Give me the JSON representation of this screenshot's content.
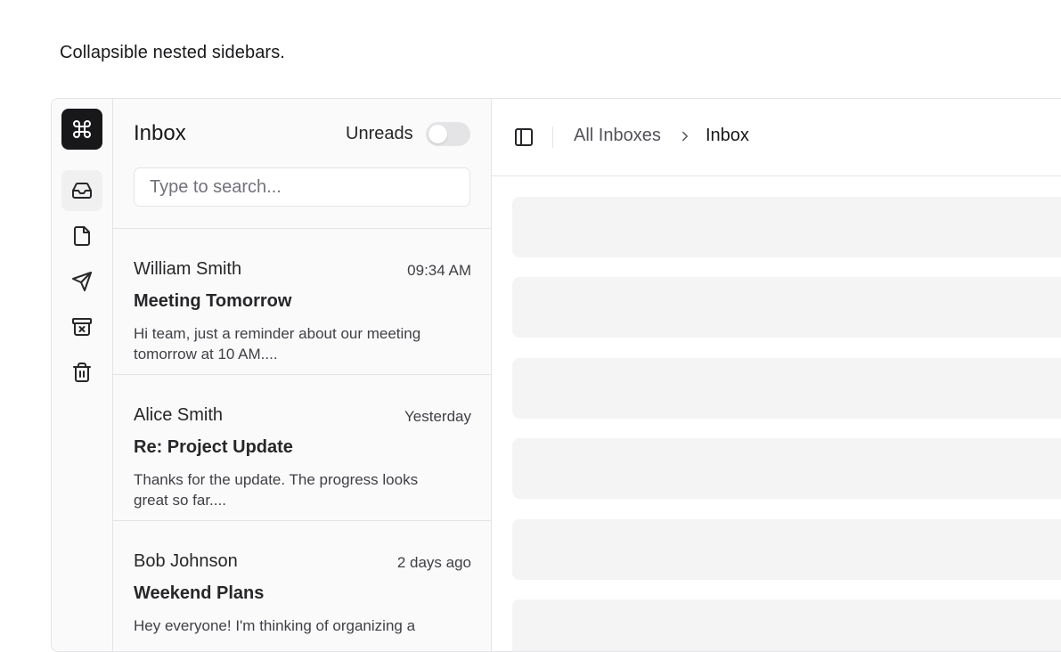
{
  "caption": "Collapsible nested sidebars.",
  "rail": {
    "logo_icon": "command-icon",
    "items": [
      {
        "icon": "inbox-icon",
        "active": true
      },
      {
        "icon": "file-icon",
        "active": false
      },
      {
        "icon": "send-icon",
        "active": false
      },
      {
        "icon": "archive-x-icon",
        "active": false
      },
      {
        "icon": "trash-icon",
        "active": false
      }
    ]
  },
  "panel": {
    "title": "Inbox",
    "unreads_label": "Unreads",
    "unreads_toggle_on": false,
    "search_placeholder": "Type to search..."
  },
  "mails": [
    {
      "from": "William Smith",
      "time": "09:34 AM",
      "subject": "Meeting Tomorrow",
      "preview": "Hi team, just a reminder about our meeting tomorrow at 10 AM...."
    },
    {
      "from": "Alice Smith",
      "time": "Yesterday",
      "subject": "Re: Project Update",
      "preview": "Thanks for the update. The progress looks great so far...."
    },
    {
      "from": "Bob Johnson",
      "time": "2 days ago",
      "subject": "Weekend Plans",
      "preview": "Hey everyone! I'm thinking of organizing a"
    }
  ],
  "header": {
    "sidebar_toggle_icon": "panel-left-icon",
    "breadcrumb_parent": "All Inboxes",
    "breadcrumb_separator_icon": "chevron-right-icon",
    "breadcrumb_current": "Inbox"
  },
  "colors": {
    "logo_bg": "#18181b",
    "skeleton": "#f4f4f5",
    "border": "#e4e4e7"
  }
}
